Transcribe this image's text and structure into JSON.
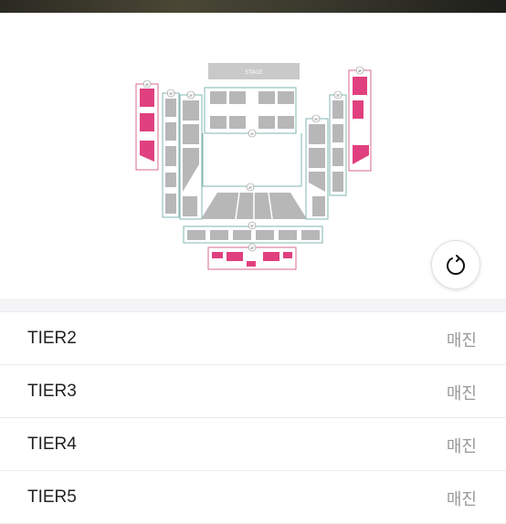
{
  "seatmap": {
    "stage_label": "STAGE",
    "floor_labels": [
      "4F",
      "3F",
      "2F",
      "1F",
      "2F",
      "3F",
      "4F",
      "2F",
      "3F",
      "4F"
    ]
  },
  "tiers": [
    {
      "name": "TIER2",
      "status": "매진"
    },
    {
      "name": "TIER3",
      "status": "매진"
    },
    {
      "name": "TIER4",
      "status": "매진"
    },
    {
      "name": "TIER5",
      "status": "매진"
    }
  ]
}
